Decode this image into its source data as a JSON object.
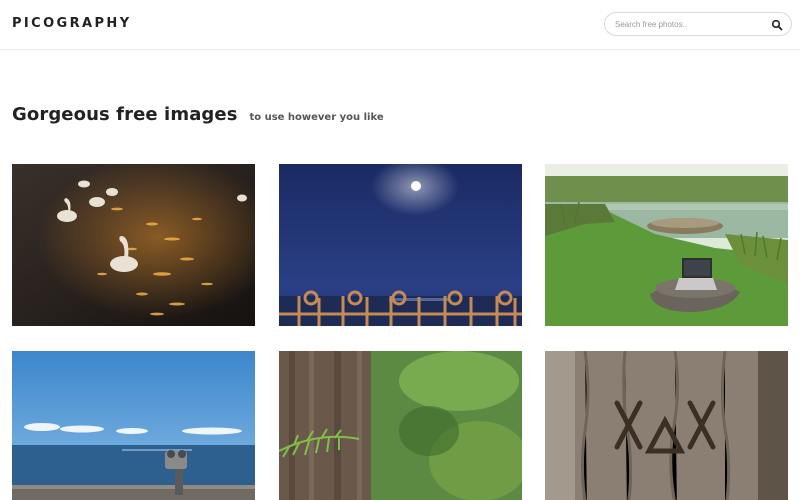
{
  "header": {
    "logo_text": "PICOGRAPHY",
    "search": {
      "placeholder": "Search free photos..",
      "icon": "search-icon"
    }
  },
  "hero": {
    "headline": "Gorgeous free images",
    "subtext": "to use however you like"
  },
  "photos": [
    {
      "subject": "swans",
      "colors": [
        "#2b2320",
        "#f2b04a"
      ]
    },
    {
      "subject": "moon-over-sea",
      "colors": [
        "#1b2d6e",
        "#ffffff"
      ]
    },
    {
      "subject": "laptop-by-pond",
      "colors": [
        "#5b8a3a",
        "#3b3b3b"
      ]
    },
    {
      "subject": "binoculars-sea",
      "colors": [
        "#3f86c9",
        "#2d5d8c"
      ]
    },
    {
      "subject": "tree-and-fern",
      "colors": [
        "#6b5a4d",
        "#6a9a3a"
      ]
    },
    {
      "subject": "carved-tree-bark",
      "colors": [
        "#8a7a6a",
        "#3b2f25"
      ]
    }
  ]
}
